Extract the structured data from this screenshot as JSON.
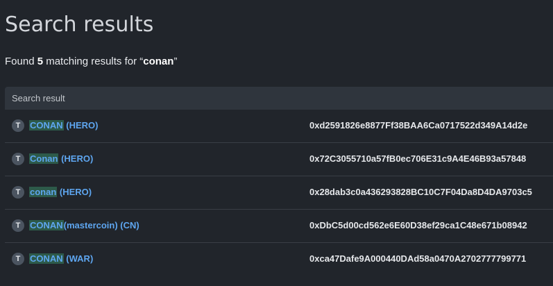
{
  "page": {
    "title": "Search results",
    "summary_prefix": "Found ",
    "summary_count": "5",
    "summary_middle": " matching results for “",
    "summary_query": "conan",
    "summary_suffix": "”"
  },
  "table": {
    "header": "Search result",
    "rows": [
      {
        "badge": "T",
        "match": "CONAN",
        "rest": " (HERO)",
        "address": "0xd2591826e8877Ff38BAA6Ca0717522d349A14d2e"
      },
      {
        "badge": "T",
        "match": "Conan",
        "rest": " (HERO)",
        "address": "0x72C3055710a57fB0ec706E31c9A4E46B93a57848"
      },
      {
        "badge": "T",
        "match": "conan",
        "rest": " (HERO)",
        "address": "0x28dab3c0a436293828BC10C7F04Da8D4DA9703c5"
      },
      {
        "badge": "T",
        "match": "CONAN",
        "rest": "(mastercoin) (CN)",
        "address": "0xDbC5d00cd562e6E60D38ef29ca1C48e671b08942"
      },
      {
        "badge": "T",
        "match": "CONAN",
        "rest": " (WAR)",
        "address": "0xca47Dafe9A000440DAd58a0470A2702777799771"
      }
    ]
  },
  "colors": {
    "background": "#21252b",
    "link": "#5ea6f0",
    "highlight": "#2d5a4a",
    "header_bg": "#2f353d"
  },
  "icons": {
    "token_badge": "token-type-icon"
  }
}
